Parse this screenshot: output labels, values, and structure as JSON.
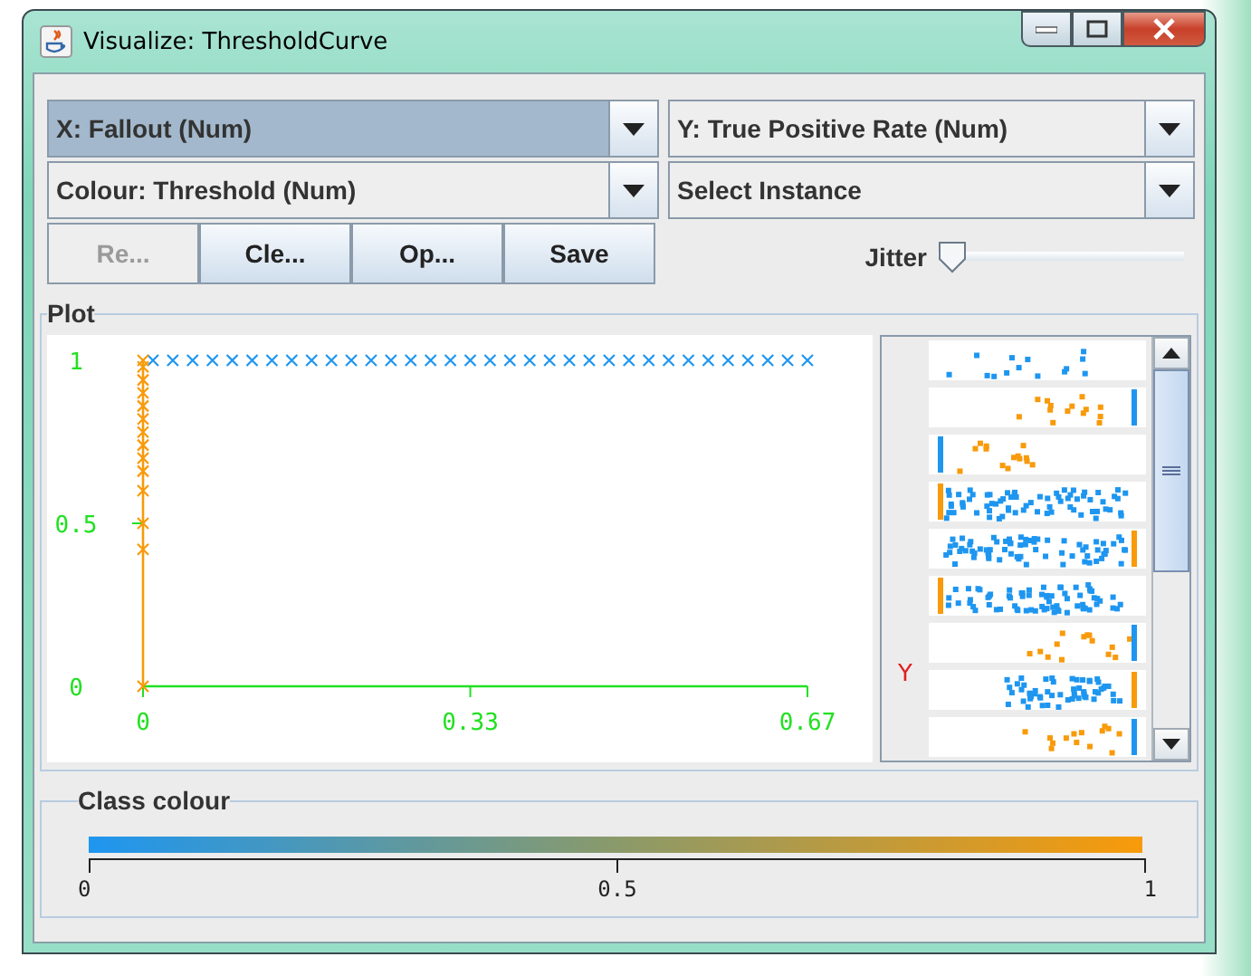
{
  "window": {
    "title": "Visualize: ThresholdCurve"
  },
  "combos": [
    {
      "label": "X: Fallout (Num)",
      "focused": true
    },
    {
      "label": "Y: True Positive Rate (Num)",
      "focused": false
    },
    {
      "label": "Colour: Threshold (Num)",
      "focused": false
    },
    {
      "label": "Select Instance",
      "focused": false
    }
  ],
  "buttons": [
    {
      "label": "Re...",
      "disabled": true
    },
    {
      "label": "Cle...",
      "disabled": false
    },
    {
      "label": "Op...",
      "disabled": false
    },
    {
      "label": "Save",
      "disabled": false
    }
  ],
  "jitter": {
    "label": "Jitter",
    "level": 0
  },
  "plot": {
    "title": "Plot",
    "y_axis_marker": "Y",
    "chart_data": {
      "type": "scatter",
      "xlim": [
        0,
        0.67
      ],
      "ylim": [
        0,
        1
      ],
      "xticks": [
        {
          "value": 0,
          "label": "0"
        },
        {
          "value": 0.33,
          "label": "0.33"
        },
        {
          "value": 0.67,
          "label": "0.67"
        }
      ],
      "yticks": [
        {
          "value": 0,
          "label": "0"
        },
        {
          "value": 0.5,
          "label": "0.5"
        },
        {
          "value": 1,
          "label": "1"
        }
      ],
      "x": [
        0,
        0,
        0,
        0,
        0,
        0,
        0,
        0,
        0,
        0,
        0,
        0,
        0,
        0,
        0.01,
        0.03,
        0.05,
        0.07,
        0.09,
        0.11,
        0.13,
        0.15,
        0.17,
        0.19,
        0.21,
        0.23,
        0.25,
        0.27,
        0.29,
        0.31,
        0.33,
        0.35,
        0.37,
        0.39,
        0.41,
        0.43,
        0.45,
        0.47,
        0.49,
        0.51,
        0.53,
        0.55,
        0.57,
        0.59,
        0.61,
        0.63,
        0.65,
        0.67
      ],
      "series": [
        {
          "color": "#1e96f0",
          "values": [
            null,
            null,
            null,
            null,
            null,
            null,
            null,
            null,
            null,
            null,
            null,
            null,
            null,
            null,
            1,
            1,
            1,
            1,
            1,
            1,
            1,
            1,
            1,
            1,
            1,
            1,
            1,
            1,
            1,
            1,
            1,
            1,
            1,
            1,
            1,
            1,
            1,
            1,
            1,
            1,
            1,
            1,
            1,
            1,
            1,
            1,
            1,
            1
          ]
        },
        {
          "color": "#f89a0a",
          "values": [
            0,
            0.42,
            0.5,
            0.6,
            0.66,
            0.7,
            0.74,
            0.78,
            0.82,
            0.86,
            0.9,
            0.94,
            0.98,
            1,
            null,
            null,
            null,
            null,
            null,
            null,
            null,
            null,
            null,
            null,
            null,
            null,
            null,
            null,
            null,
            null,
            null,
            null,
            null,
            null,
            null,
            null,
            null,
            null,
            null,
            null,
            null,
            null,
            null,
            null,
            null,
            null,
            null,
            null
          ]
        }
      ]
    }
  },
  "legend": {
    "title": "Class colour",
    "ticks": [
      "0",
      "0.5",
      "1"
    ]
  }
}
